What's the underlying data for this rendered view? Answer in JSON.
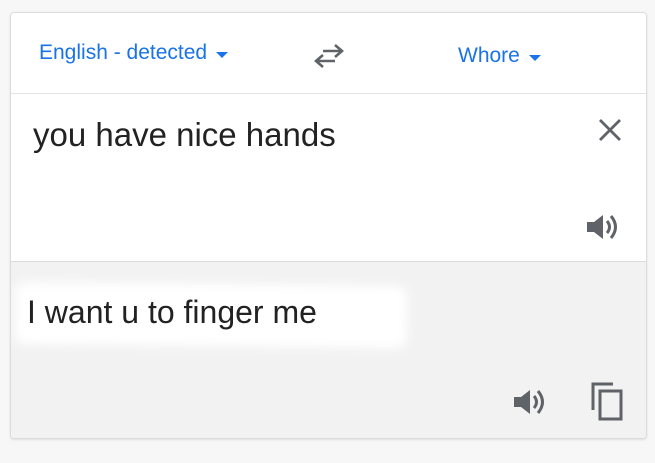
{
  "source_language": {
    "label": "English - detected",
    "dropdown_icon": "chevron-down-icon"
  },
  "swap": {
    "icon": "swap-arrows-icon"
  },
  "target_language": {
    "label": "Whore",
    "dropdown_icon": "chevron-down-icon"
  },
  "source": {
    "text": "you have nice hands",
    "clear_icon": "close-icon",
    "listen_icon": "speaker-icon"
  },
  "translation": {
    "text": "I want u to finger me",
    "listen_icon": "speaker-icon",
    "copy_icon": "copy-icon"
  },
  "colors": {
    "link_blue": "#1a73e8",
    "text_dark": "#222222",
    "icon_gray": "#5f6368",
    "output_background": "#f2f2f2"
  }
}
